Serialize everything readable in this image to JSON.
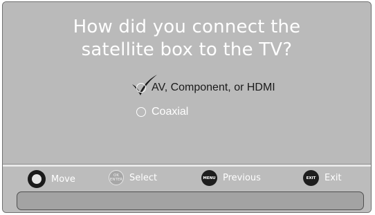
{
  "question": {
    "line1": "How did you connect the",
    "line2": "satellite box to the TV?"
  },
  "options": [
    {
      "label": "AV, Component, or HDMI",
      "selected": true
    },
    {
      "label": "Coaxial",
      "selected": false
    }
  ],
  "footer": {
    "move_label": "Move",
    "select_label": "Select",
    "ok_icon_top": "OK",
    "ok_icon_bottom": "ENTER",
    "previous_label": "Previous",
    "menu_icon_text": "MENU",
    "exit_label": "Exit",
    "exit_icon_text": "EXIT"
  },
  "colors": {
    "background": "#bababa",
    "text_primary": "#ffffff",
    "selected_text": "#1a1a1a"
  }
}
